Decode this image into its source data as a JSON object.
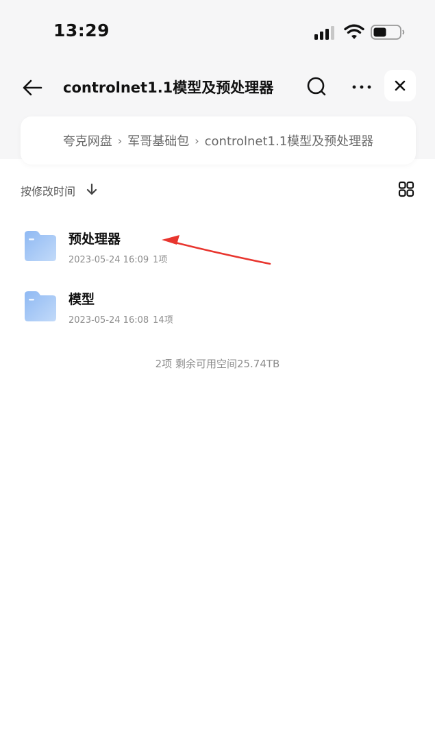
{
  "status_bar": {
    "time": "13:29"
  },
  "nav": {
    "title": "controlnet1.1模型及预处理器"
  },
  "breadcrumb": {
    "items": [
      "夸克网盘",
      "军哥基础包",
      "controlnet1.1模型及预处理器"
    ],
    "separator": "›"
  },
  "sort": {
    "label": "按修改时间"
  },
  "files": [
    {
      "name": "预处理器",
      "date": "2023-05-24 16:09",
      "count": "1项"
    },
    {
      "name": "模型",
      "date": "2023-05-24 16:08",
      "count": "14项"
    }
  ],
  "summary": "2项 剩余可用空间25.74TB",
  "colors": {
    "folder": "#a9cbf7",
    "annotation_arrow": "#e8352e",
    "header_bg": "#f6f6f7"
  },
  "icons": [
    "signal-icon",
    "wifi-icon",
    "battery-icon",
    "back-arrow-icon",
    "search-icon",
    "more-icon",
    "close-icon",
    "sort-down-arrow-icon",
    "grid-view-icon",
    "folder-icon"
  ]
}
